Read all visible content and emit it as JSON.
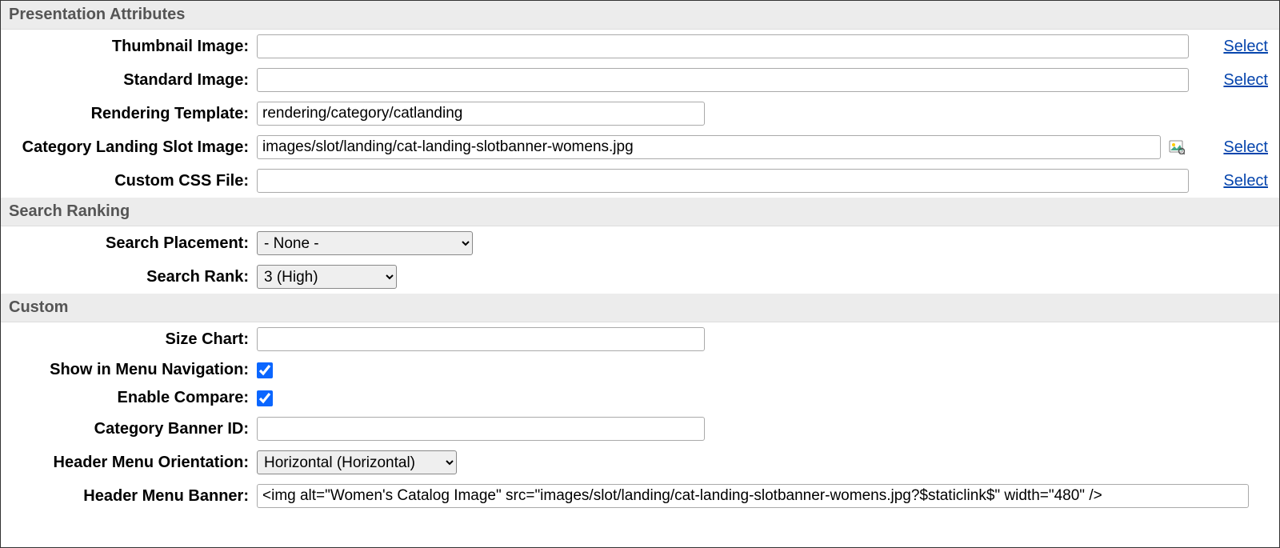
{
  "sections": {
    "presentation": {
      "title": "Presentation Attributes",
      "thumbnail_label": "Thumbnail Image:",
      "thumbnail_value": "",
      "standard_label": "Standard Image:",
      "standard_value": "",
      "rendering_label": "Rendering Template:",
      "rendering_value": "rendering/category/catlanding",
      "slotimg_label": "Category Landing Slot Image:",
      "slotimg_value": "images/slot/landing/cat-landing-slotbanner-womens.jpg",
      "css_label": "Custom CSS File:",
      "css_value": "",
      "select_link": "Select"
    },
    "ranking": {
      "title": "Search Ranking",
      "placement_label": "Search Placement:",
      "placement_value": "- None -",
      "rank_label": "Search Rank:",
      "rank_value": "3 (High)"
    },
    "custom": {
      "title": "Custom",
      "sizechart_label": "Size Chart:",
      "sizechart_value": "",
      "showmenu_label": "Show in Menu Navigation:",
      "showmenu_checked": true,
      "compare_label": "Enable Compare:",
      "compare_checked": true,
      "bannerid_label": "Category Banner ID:",
      "bannerid_value": "",
      "orientation_label": "Header Menu Orientation:",
      "orientation_value": "Horizontal (Horizontal)",
      "banner_label": "Header Menu Banner:",
      "banner_value": "<img alt=\"Women's Catalog Image\" src=\"images/slot/landing/cat-landing-slotbanner-womens.jpg?$staticlink$\" width=\"480\" />"
    }
  }
}
